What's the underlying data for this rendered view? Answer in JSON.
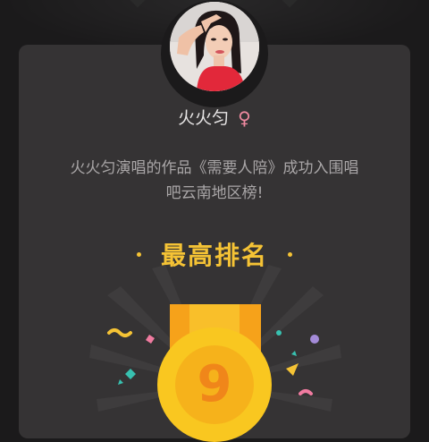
{
  "profile": {
    "username": "火火匀",
    "gender_icon": "female-icon",
    "gender_glyph": "♀"
  },
  "message": {
    "line1": "火火匀演唱的作品《需要人陪》成功入围唱",
    "line2": "吧云南地区榜!"
  },
  "rank": {
    "title": "最高排名",
    "value": "9"
  },
  "colors": {
    "background": "#1b1a1b",
    "card": "#353334",
    "accent": "#f5c335",
    "gender": "#f08aa0",
    "medal": "#f9c720",
    "medal_number": "#f0861a"
  }
}
